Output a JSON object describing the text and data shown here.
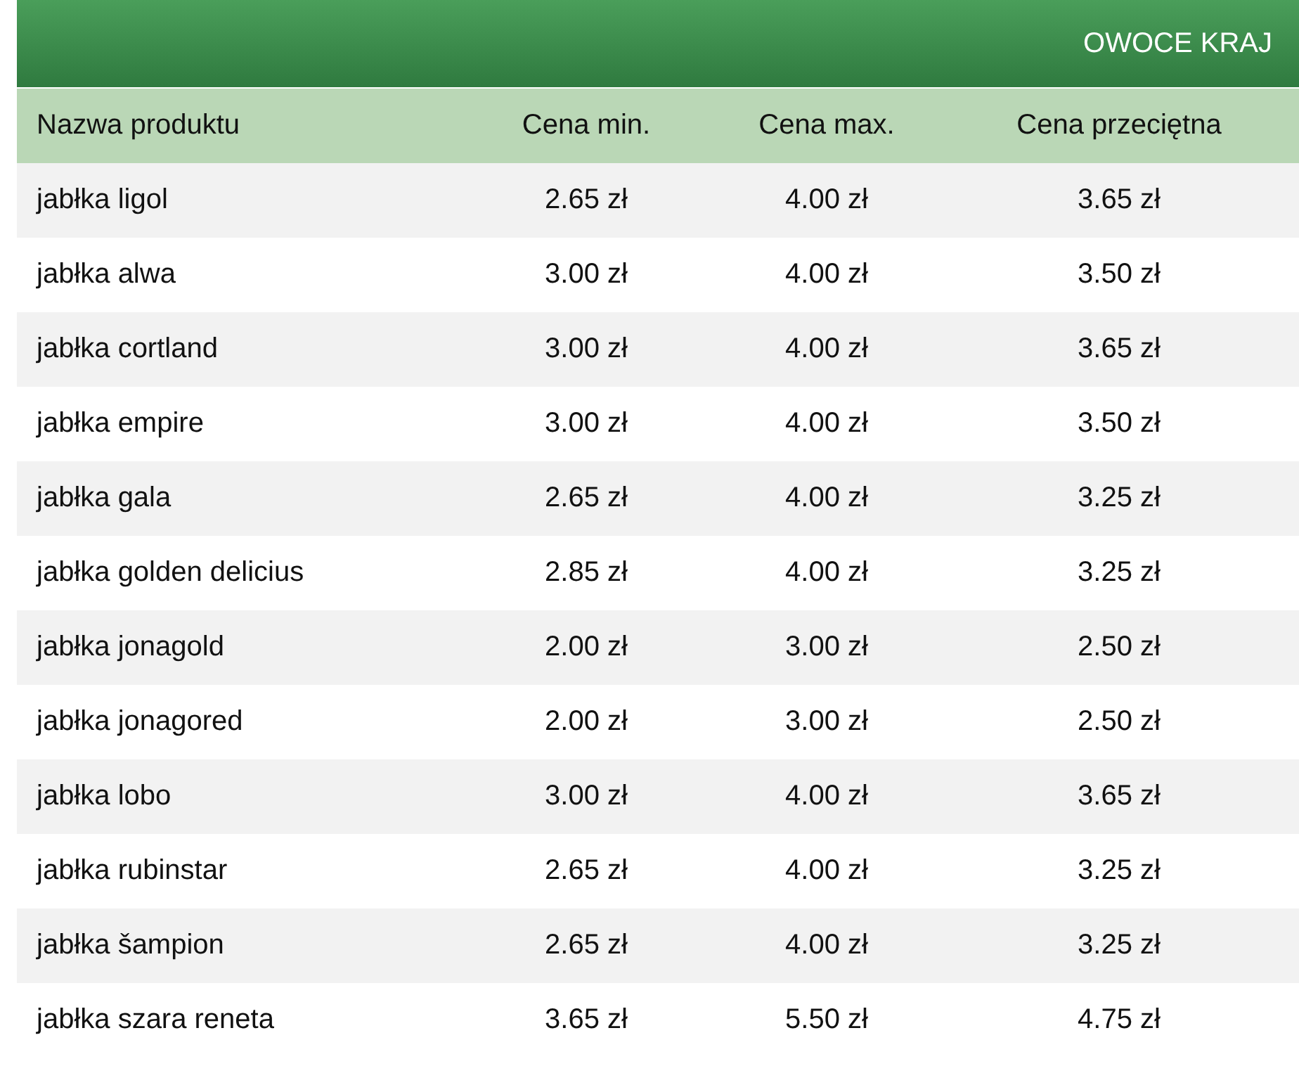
{
  "title": "OWOCE KRAJ",
  "columns": [
    "Nazwa produktu",
    "Cena min.",
    "Cena max.",
    "Cena przeciętna"
  ],
  "rows": [
    [
      "jabłka ligol",
      "2.65 zł",
      "4.00 zł",
      "3.65 zł"
    ],
    [
      "jabłka alwa",
      "3.00 zł",
      "4.00 zł",
      "3.50 zł"
    ],
    [
      "jabłka cortland",
      "3.00 zł",
      "4.00 zł",
      "3.65 zł"
    ],
    [
      "jabłka empire",
      "3.00 zł",
      "4.00 zł",
      "3.50 zł"
    ],
    [
      "jabłka gala",
      "2.65 zł",
      "4.00 zł",
      "3.25 zł"
    ],
    [
      "jabłka golden delicius",
      "2.85 zł",
      "4.00 zł",
      "3.25 zł"
    ],
    [
      "jabłka jonagold",
      "2.00 zł",
      "3.00 zł",
      "2.50 zł"
    ],
    [
      "jabłka jonagored",
      "2.00 zł",
      "3.00 zł",
      "2.50 zł"
    ],
    [
      "jabłka lobo",
      "3.00 zł",
      "4.00 zł",
      "3.65 zł"
    ],
    [
      "jabłka rubinstar",
      "2.65 zł",
      "4.00 zł",
      "3.25 zł"
    ],
    [
      "jabłka šampion",
      "2.65 zł",
      "4.00 zł",
      "3.25 zł"
    ],
    [
      "jabłka szara reneta",
      "3.65 zł",
      "5.50 zł",
      "4.75 zł"
    ]
  ]
}
